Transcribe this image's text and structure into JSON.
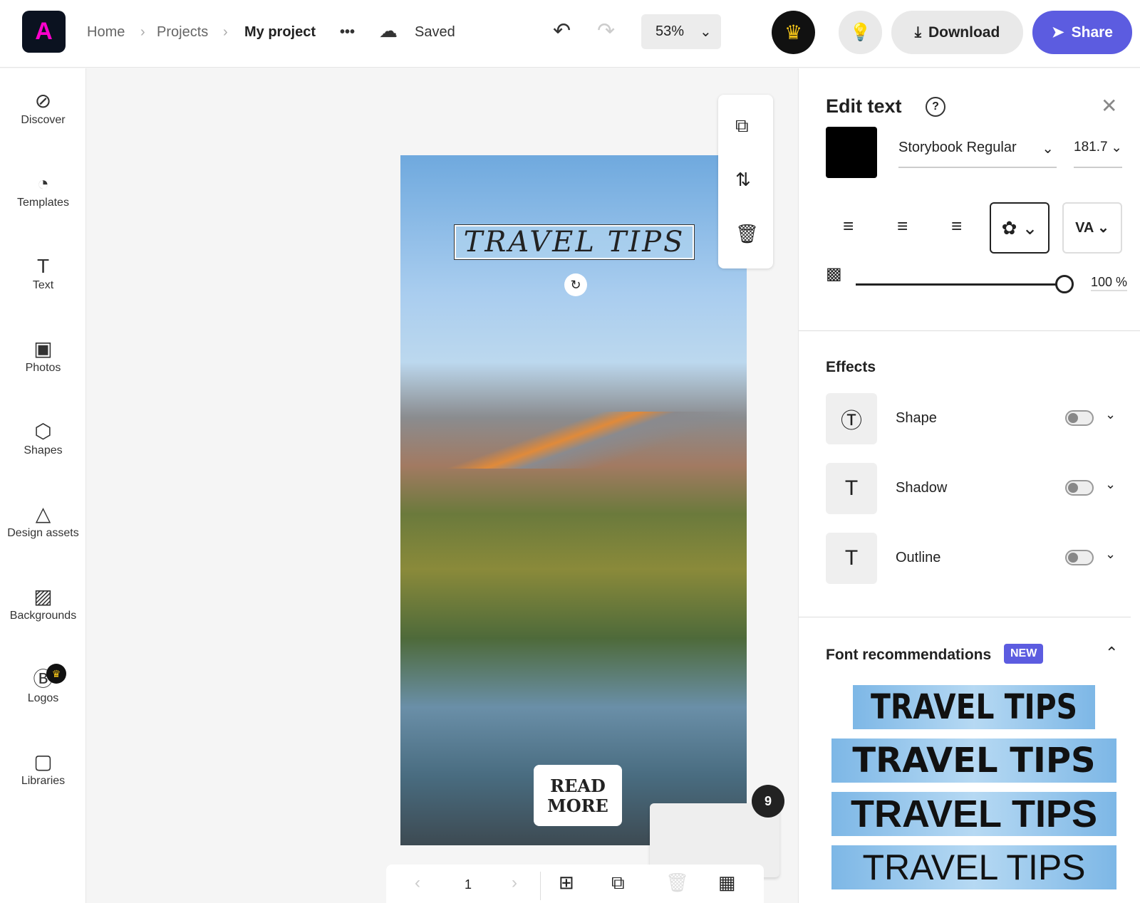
{
  "header": {
    "breadcrumb": [
      "Home",
      "Projects",
      "My project"
    ],
    "more": "•••",
    "status": "Saved",
    "zoom": "53%",
    "download": "Download",
    "share": "Share"
  },
  "sidebar": {
    "items": [
      {
        "label": "Discover",
        "icon": "compass-icon"
      },
      {
        "label": "Templates",
        "icon": "templates-icon"
      },
      {
        "label": "Text",
        "icon": "text-icon"
      },
      {
        "label": "Photos",
        "icon": "photo-icon"
      },
      {
        "label": "Shapes",
        "icon": "shapes-icon"
      },
      {
        "label": "Design assets",
        "icon": "design-assets-icon"
      },
      {
        "label": "Backgrounds",
        "icon": "backgrounds-icon"
      },
      {
        "label": "Logos",
        "icon": "logos-icon"
      },
      {
        "label": "Libraries",
        "icon": "libraries-icon"
      }
    ]
  },
  "canvas": {
    "title_text": "TRAVEL TIPS",
    "button_text": [
      "READ",
      "MORE"
    ],
    "page": "1",
    "page_count_badge": "9"
  },
  "panel": {
    "title": "Edit text",
    "font": "Storybook Regular",
    "size": "181.7",
    "color": "#000000",
    "opacity": "100 %",
    "opacity_value": 100,
    "effects_title": "Effects",
    "effects": [
      {
        "label": "Shape",
        "on": false
      },
      {
        "label": "Shadow",
        "on": false
      },
      {
        "label": "Outline",
        "on": false
      }
    ],
    "recs_title": "Font recommendations",
    "new_badge": "NEW",
    "recs": [
      "TRAVEL TIPS",
      "TRAVEL TIPS",
      "TRAVEL TIPS",
      "TRAVEL TIPS"
    ]
  },
  "colors": {
    "accent": "#5c5ce0",
    "premium": "#f5c518"
  }
}
